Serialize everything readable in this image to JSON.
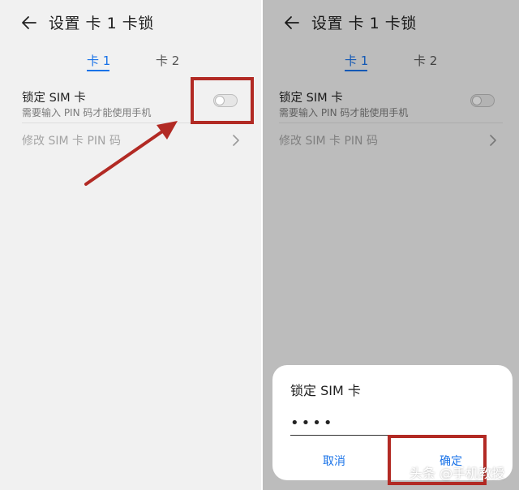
{
  "left_screen": {
    "header": {
      "title": "设置 卡 1 卡锁"
    },
    "tabs": [
      {
        "label": "卡 1",
        "active": true
      },
      {
        "label": "卡 2",
        "active": false
      }
    ],
    "lock_sim": {
      "title": "锁定 SIM 卡",
      "subtitle": "需要输入 PIN 码才能使用手机",
      "toggle_on": false
    },
    "change_pin": {
      "label": "修改 SIM 卡 PIN 码"
    }
  },
  "right_screen": {
    "header": {
      "title": "设置 卡 1 卡锁"
    },
    "tabs": [
      {
        "label": "卡 1",
        "active": true
      },
      {
        "label": "卡 2",
        "active": false
      }
    ],
    "lock_sim": {
      "title": "锁定 SIM 卡",
      "subtitle": "需要输入 PIN 码才能使用手机",
      "toggle_on": false
    },
    "change_pin": {
      "label": "修改 SIM 卡 PIN 码"
    },
    "dialog": {
      "title": "锁定 SIM 卡",
      "pin_value": "••••",
      "cancel_label": "取消",
      "confirm_label": "确定"
    }
  },
  "watermark": "头条 @手机教授",
  "colors": {
    "accent": "#1a73e8",
    "annotation_red": "#b22a24",
    "background": "#f1f1f1"
  }
}
